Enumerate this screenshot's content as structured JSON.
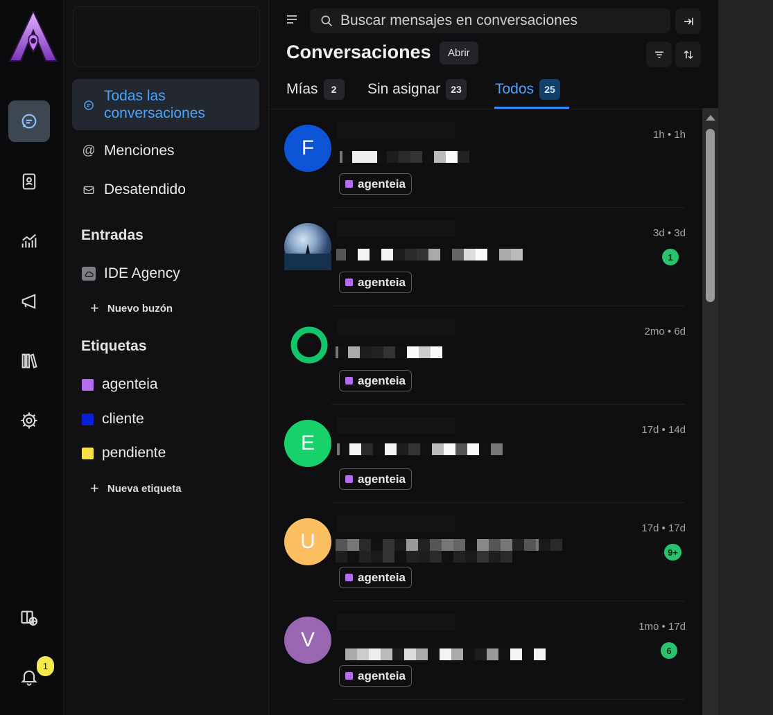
{
  "brand": {
    "logo_letter": "A",
    "colors": {
      "accent": "#b46cf0",
      "active_blue": "#4aa3ff"
    }
  },
  "rail": {
    "items": [
      {
        "name": "conversations",
        "icon": "chat-icon",
        "active": true
      },
      {
        "name": "contacts",
        "icon": "contact-book-icon"
      },
      {
        "name": "reports",
        "icon": "chart-icon"
      },
      {
        "name": "campaigns",
        "icon": "megaphone-icon"
      },
      {
        "name": "library",
        "icon": "library-icon"
      },
      {
        "name": "settings",
        "icon": "gear-icon"
      },
      {
        "name": "portal",
        "icon": "help-center-icon"
      },
      {
        "name": "notifications",
        "icon": "bell-icon",
        "badge": "1"
      }
    ]
  },
  "sidebar": {
    "all_conversations": "Todas las conversaciones",
    "mentions": "Menciones",
    "unattended": "Desatendido",
    "inboxes_title": "Entradas",
    "inbox_name": "IDE Agency",
    "new_inbox": "Nuevo buzón",
    "labels_title": "Etiquetas",
    "labels": [
      {
        "name": "agenteia",
        "color": "#b46cf0"
      },
      {
        "name": "cliente",
        "color": "#0a1fd6"
      },
      {
        "name": "pendiente",
        "color": "#f7e048"
      }
    ],
    "new_label": "Nueva etiqueta"
  },
  "header": {
    "search_placeholder": "Buscar mensajes en conversaciones",
    "title": "Conversaciones",
    "status_filter": "Abrir",
    "tabs": [
      {
        "label": "Mías",
        "count": "2"
      },
      {
        "label": "Sin asignar",
        "count": "23"
      },
      {
        "label": "Todos",
        "count": "25",
        "active": true
      }
    ]
  },
  "conversations": [
    {
      "avatar_letter": "F",
      "avatar_color": "#0b55d6",
      "time": "1h • 1h",
      "label": "agenteia",
      "unread": ""
    },
    {
      "avatar_letter": "",
      "avatar_color": "photo",
      "time": "3d • 3d",
      "label": "agenteia",
      "unread": "1"
    },
    {
      "avatar_letter": "",
      "avatar_color": "ring",
      "time": "2mo • 6d",
      "label": "agenteia",
      "unread": ""
    },
    {
      "avatar_letter": "E",
      "avatar_color": "#17d16a",
      "time": "17d • 14d",
      "label": "agenteia",
      "unread": ""
    },
    {
      "avatar_letter": "U",
      "avatar_color": "#fbbf62",
      "time": "17d • 17d",
      "label": "agenteia",
      "unread": "9+"
    },
    {
      "avatar_letter": "V",
      "avatar_color": "#9a67b3",
      "time": "1mo • 17d",
      "label": "agenteia",
      "unread": "6"
    }
  ]
}
